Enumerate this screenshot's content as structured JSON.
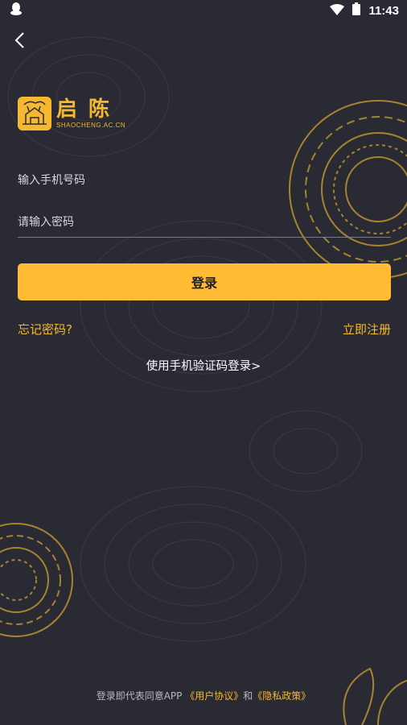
{
  "status_bar": {
    "time": "11:43"
  },
  "logo": {
    "title": "启陈",
    "subtitle": "SHAOCHENG.AC.CN"
  },
  "form": {
    "phone_placeholder": "输入手机号码",
    "password_placeholder": "请输入密码",
    "login_label": "登录"
  },
  "links": {
    "forgot_password": "忘记密码?",
    "register_now": "立即注册",
    "sms_login": "使用手机验证码登录>"
  },
  "footer": {
    "prefix": "登录即代表同意APP",
    "user_agreement": "《用户协议》",
    "conjunction": "和",
    "privacy_policy": "《隐私政策》"
  },
  "colors": {
    "accent": "#ffbb33",
    "background": "#2a2a34"
  }
}
